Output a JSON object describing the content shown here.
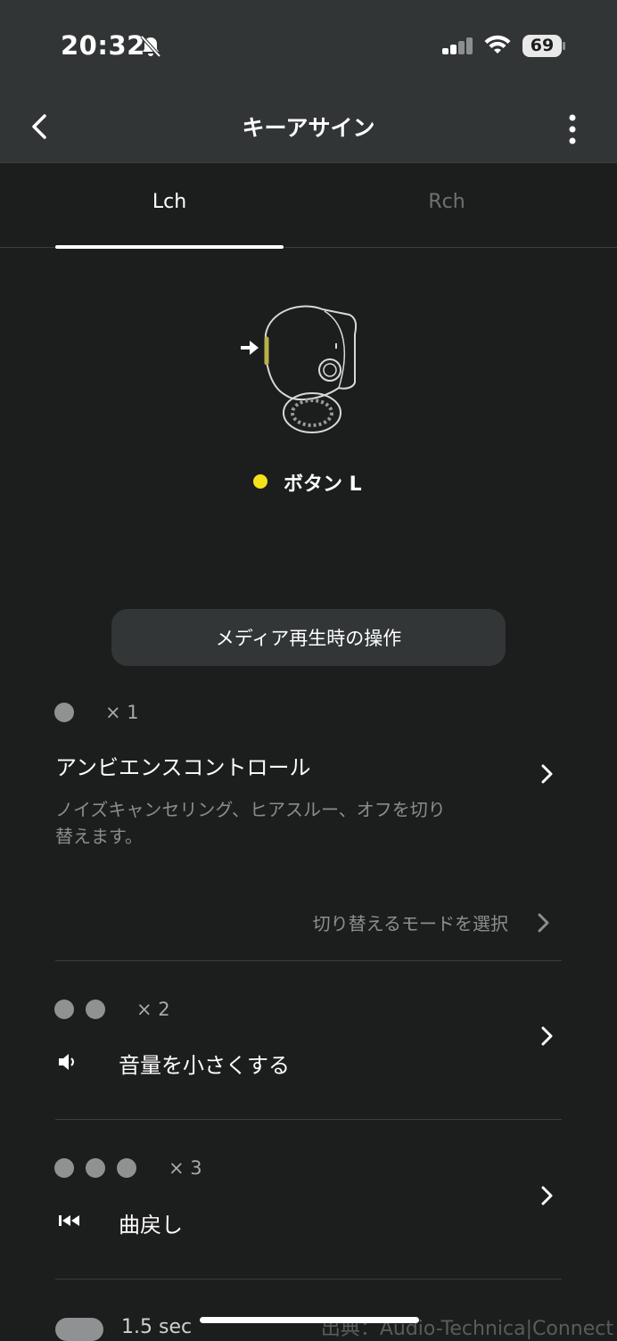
{
  "status_bar": {
    "time": "20:32",
    "battery": "69"
  },
  "header": {
    "title": "キーアサイン"
  },
  "tabs": [
    {
      "label": "Lch"
    },
    {
      "label": "Rch"
    }
  ],
  "button": {
    "label": "ボタン L"
  },
  "section": {
    "label": "メディア再生時の操作"
  },
  "items": [
    {
      "count": "× 1",
      "title": "アンビエンスコントロール",
      "desc_line1": "ノイズキャンセリング、ヒアスルー、オフを切り",
      "desc_line2": "替えます。",
      "sub_link": "切り替えるモードを選択"
    },
    {
      "count": "× 2",
      "title": "音量を小さくする"
    },
    {
      "count": "× 3",
      "title": "曲戻し"
    },
    {
      "count": "1.5 sec"
    }
  ],
  "watermark": "出典：Audio-Technica|Connect",
  "colors": {
    "accent_yellow": "#f5e21a",
    "header_bg": "#323536",
    "page_bg": "#1c1d1d"
  }
}
